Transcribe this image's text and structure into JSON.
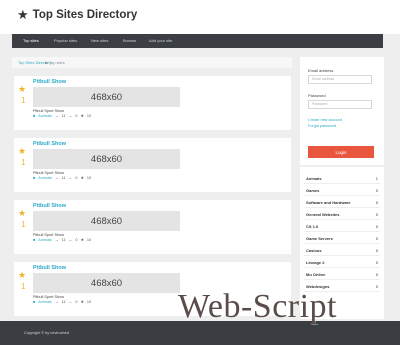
{
  "header": {
    "logo_star": "★",
    "title": "Top Sites Directory"
  },
  "nav": {
    "items": [
      "Top sites",
      "Popular sites",
      "New sites",
      "Browse",
      "Add your site"
    ]
  },
  "breadcrumb": {
    "home": "Top Sites Directory",
    "separator": "▶",
    "current": "Top sites"
  },
  "sites": [
    {
      "rank": "1",
      "title": "Pitbull Show",
      "banner": "468x60",
      "description": "Pitbull Sport Show",
      "category": "Animals",
      "stat_in": "11",
      "stat_out": "0",
      "stat_score": "10"
    },
    {
      "rank": "1",
      "title": "Pitbull Show",
      "banner": "468x60",
      "description": "Pitbull Sport Show",
      "category": "Animals",
      "stat_in": "11",
      "stat_out": "0",
      "stat_score": "10"
    },
    {
      "rank": "1",
      "title": "Pitbull Show",
      "banner": "468x60",
      "description": "Pitbull Sport Show",
      "category": "Animals",
      "stat_in": "11",
      "stat_out": "0",
      "stat_score": "10"
    },
    {
      "rank": "1",
      "title": "Pitbull Show",
      "banner": "468x60",
      "description": "Pitbull Sport Show",
      "category": "Animals",
      "stat_in": "11",
      "stat_out": "0",
      "stat_score": "10"
    }
  ],
  "login": {
    "email_label": "Email address",
    "email_placeholder": "Email address",
    "password_label": "Password",
    "password_placeholder": "Password",
    "create_account": "Create new account",
    "forgot_password": "Forgot password",
    "login_button": "Login"
  },
  "categories": [
    {
      "name": "Animals",
      "count": "1"
    },
    {
      "name": "Games",
      "count": "0"
    },
    {
      "name": "Software and Hardware",
      "count": "0"
    },
    {
      "name": "General Websites",
      "count": "0"
    },
    {
      "name": "CS 1.6",
      "count": "0"
    },
    {
      "name": "Game Servers",
      "count": "0"
    },
    {
      "name": "Casinos",
      "count": "0"
    },
    {
      "name": "Lineage 2",
      "count": "0"
    },
    {
      "name": "Mu Online",
      "count": "0"
    },
    {
      "name": "Webdesigns",
      "count": "0"
    }
  ],
  "footer": {
    "copyright": "Copyright © by nevtroshed"
  },
  "watermark": "Web-Script",
  "colors": {
    "accent": "#2aa9c7",
    "star": "#f0b429",
    "button": "#e8573d",
    "nav_bg": "#3b3f43"
  }
}
